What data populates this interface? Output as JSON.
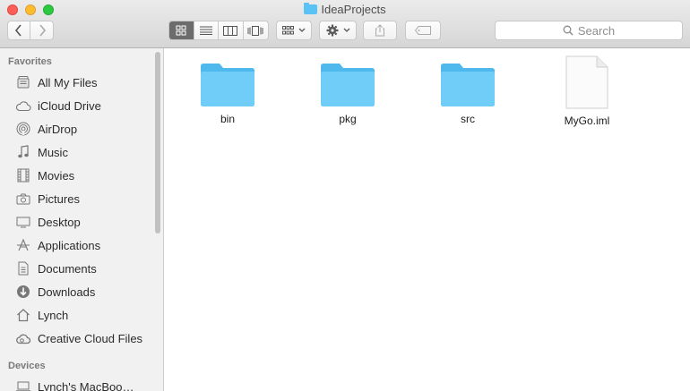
{
  "window": {
    "title": "IdeaProjects"
  },
  "toolbar": {
    "search_placeholder": "Search",
    "views": [
      "icon-view",
      "list-view",
      "column-view",
      "cover-flow-view"
    ],
    "active_view": "icon-view"
  },
  "sidebar": {
    "favorites_header": "Favorites",
    "favorites": [
      {
        "label": "All My Files",
        "icon": "all-files-icon"
      },
      {
        "label": "iCloud Drive",
        "icon": "cloud-icon"
      },
      {
        "label": "AirDrop",
        "icon": "airdrop-icon"
      },
      {
        "label": "Music",
        "icon": "music-icon"
      },
      {
        "label": "Movies",
        "icon": "film-icon"
      },
      {
        "label": "Pictures",
        "icon": "camera-icon"
      },
      {
        "label": "Desktop",
        "icon": "desktop-icon"
      },
      {
        "label": "Applications",
        "icon": "applications-icon"
      },
      {
        "label": "Documents",
        "icon": "document-icon"
      },
      {
        "label": "Downloads",
        "icon": "download-icon"
      },
      {
        "label": "Lynch",
        "icon": "home-icon"
      },
      {
        "label": "Creative Cloud Files",
        "icon": "creative-cloud-icon"
      }
    ],
    "devices_header": "Devices",
    "devices": [
      {
        "label": "Lynch's MacBoo…",
        "icon": "laptop-icon"
      }
    ]
  },
  "files": [
    {
      "name": "bin",
      "kind": "folder"
    },
    {
      "name": "pkg",
      "kind": "folder"
    },
    {
      "name": "src",
      "kind": "folder"
    },
    {
      "name": "MyGo.iml",
      "kind": "file"
    }
  ],
  "colors": {
    "folder": "#5bc2f5",
    "active_view": "#6c6c6c"
  }
}
